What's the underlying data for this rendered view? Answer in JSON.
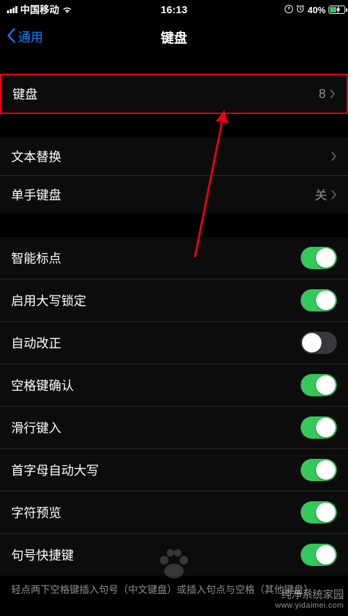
{
  "status": {
    "carrier": "中国移动",
    "time": "16:13",
    "battery_pct": "40%"
  },
  "nav": {
    "back_label": "通用",
    "title": "键盘"
  },
  "group1": {
    "keyboards": {
      "label": "键盘",
      "count": "8"
    }
  },
  "group2": {
    "text_replace": {
      "label": "文本替换"
    },
    "one_handed": {
      "label": "单手键盘",
      "value": "关"
    }
  },
  "toggles": [
    {
      "label": "智能标点",
      "on": true
    },
    {
      "label": "启用大写锁定",
      "on": true
    },
    {
      "label": "自动改正",
      "on": false
    },
    {
      "label": "空格键确认",
      "on": true
    },
    {
      "label": "滑行键入",
      "on": true
    },
    {
      "label": "首字母自动大写",
      "on": true
    },
    {
      "label": "字符预览",
      "on": true
    },
    {
      "label": "句号快捷键",
      "on": true
    }
  ],
  "footer": "轻点两下空格键插入句号（中文键盘）或插入句点与空格（其他键盘）。",
  "watermark": {
    "line1": "纯净系统家园",
    "line2": "www.yidaimei.com"
  }
}
